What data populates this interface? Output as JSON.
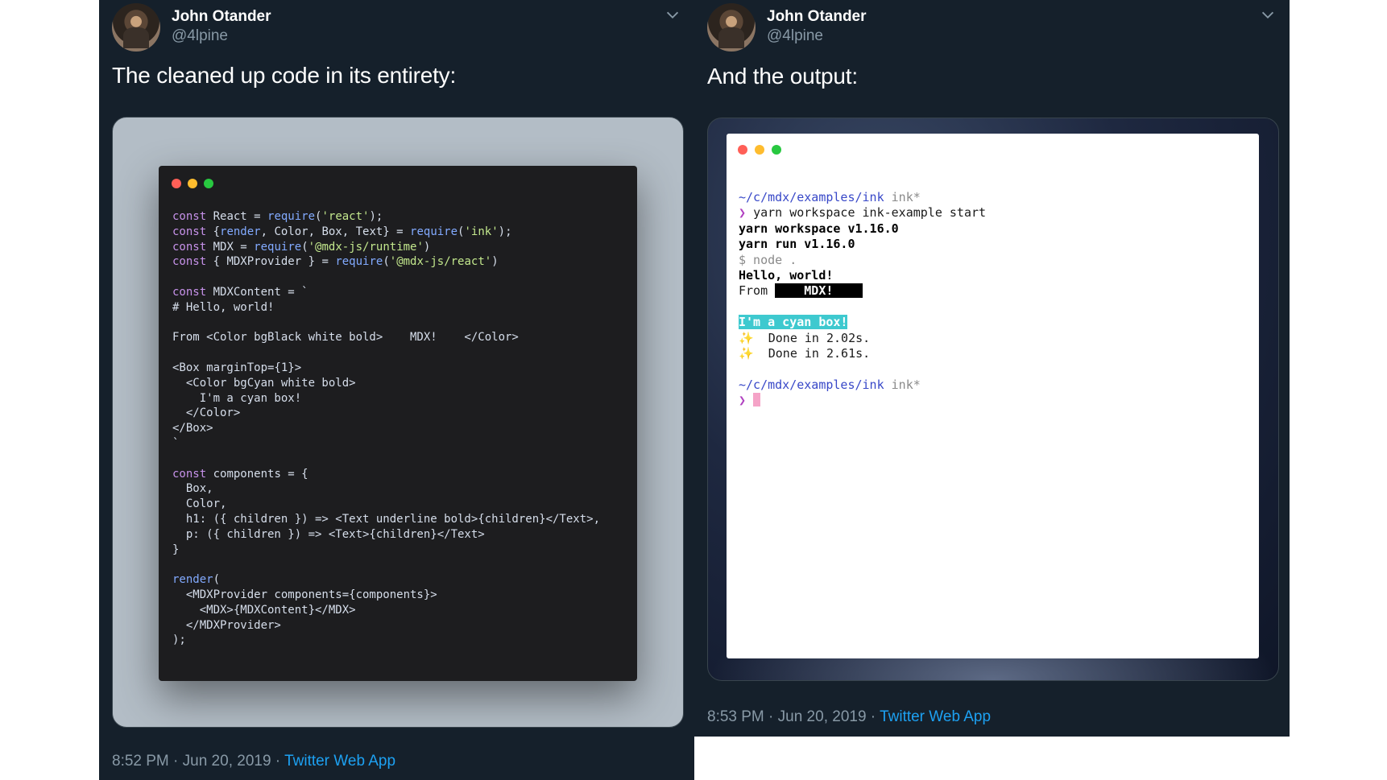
{
  "tweets": [
    {
      "author": {
        "name": "John Otander",
        "handle": "@4lpine"
      },
      "text": "The cleaned up code in its entirety:",
      "timestamp": "8:52 PM · Jun 20, 2019 · ",
      "source": "Twitter Web App",
      "code_lines": [
        "const React = require('react');",
        "const {render, Color, Box, Text} = require('ink');",
        "const MDX = require('@mdx-js/runtime')",
        "const { MDXProvider } = require('@mdx-js/react')",
        "",
        "const MDXContent = `",
        "# Hello, world!",
        "",
        "From <Color bgBlack white bold>    MDX!    </Color>",
        "",
        "<Box marginTop={1}>",
        "  <Color bgCyan white bold>",
        "    I'm a cyan box!",
        "  </Color>",
        "</Box>",
        "`",
        "",
        "const components = {",
        "  Box,",
        "  Color,",
        "  h1: ({ children }) => <Text underline bold>{children}</Text>,",
        "  p: ({ children }) => <Text>{children}</Text>",
        "}",
        "",
        "render(",
        "  <MDXProvider components={components}>",
        "    <MDX>{MDXContent}</MDX>",
        "  </MDXProvider>",
        ");"
      ]
    },
    {
      "author": {
        "name": "John Otander",
        "handle": "@4lpine"
      },
      "text": "And the output:",
      "timestamp": "8:53 PM · Jun 20, 2019 · ",
      "source": "Twitter Web App",
      "terminal": {
        "path": "~/c/mdx/examples/ink",
        "branch": "ink*",
        "prompt": "❯",
        "command": "yarn workspace ink-example start",
        "line_workspace": "yarn workspace v1.16.0",
        "line_run": "yarn run v1.16.0",
        "line_node": "$ node .",
        "line_hello": "Hello, world!",
        "from_label": "From",
        "mdx_box": "    MDX!    ",
        "cyan_box": "I'm a cyan box!",
        "sparkle": "✨",
        "done_1": "Done in 2.02s.",
        "done_2": "Done in 2.61s."
      }
    }
  ],
  "colors": {
    "background": "#15202b",
    "link": "#1da1f2",
    "muted": "#8899a6"
  }
}
